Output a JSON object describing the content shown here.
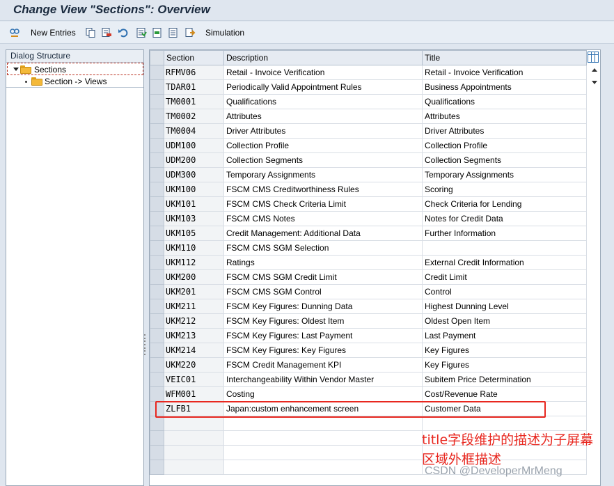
{
  "window": {
    "title": "Change View \"Sections\": Overview"
  },
  "toolbar": {
    "new_entries_label": "New Entries",
    "simulation_label": "Simulation",
    "icons": [
      "display-change-icon",
      "new-entries-icon",
      "copy-icon",
      "delete-icon",
      "undo-icon",
      "select-all-icon",
      "select-block-icon",
      "deselect-all-icon",
      "transport-icon"
    ]
  },
  "dialog_structure": {
    "header": "Dialog Structure",
    "nodes": [
      {
        "label": "Sections",
        "expanded": true,
        "selected": true
      },
      {
        "label": "Section -> Views"
      }
    ]
  },
  "table": {
    "columns": [
      "Section",
      "Description",
      "Title"
    ],
    "rows": [
      {
        "section": "RFMV06",
        "description": "Retail - Invoice Verification",
        "title": "Retail - Invoice Verification"
      },
      {
        "section": "TDAR01",
        "description": "Periodically Valid Appointment Rules",
        "title": "Business Appointments"
      },
      {
        "section": "TM0001",
        "description": "Qualifications",
        "title": "Qualifications"
      },
      {
        "section": "TM0002",
        "description": "Attributes",
        "title": "Attributes"
      },
      {
        "section": "TM0004",
        "description": "Driver Attributes",
        "title": "Driver Attributes"
      },
      {
        "section": "UDM100",
        "description": "Collection Profile",
        "title": "Collection Profile"
      },
      {
        "section": "UDM200",
        "description": "Collection Segments",
        "title": "Collection Segments"
      },
      {
        "section": "UDM300",
        "description": "Temporary Assignments",
        "title": "Temporary Assignments"
      },
      {
        "section": "UKM100",
        "description": "FSCM CMS Creditworthiness Rules",
        "title": "Scoring"
      },
      {
        "section": "UKM101",
        "description": "FSCM CMS Check Criteria Limit",
        "title": "Check Criteria for Lending"
      },
      {
        "section": "UKM103",
        "description": "FSCM CMS Notes",
        "title": "Notes for Credit Data"
      },
      {
        "section": "UKM105",
        "description": "Credit Management: Additional Data",
        "title": "Further Information"
      },
      {
        "section": "UKM110",
        "description": "FSCM CMS SGM Selection",
        "title": ""
      },
      {
        "section": "UKM112",
        "description": "Ratings",
        "title": "External Credit Information"
      },
      {
        "section": "UKM200",
        "description": "FSCM CMS SGM Credit Limit",
        "title": "Credit Limit"
      },
      {
        "section": "UKM201",
        "description": "FSCM CMS SGM Control",
        "title": "Control"
      },
      {
        "section": "UKM211",
        "description": "FSCM Key Figures: Dunning Data",
        "title": "Highest Dunning Level"
      },
      {
        "section": "UKM212",
        "description": "FSCM Key Figures: Oldest Item",
        "title": "Oldest Open Item"
      },
      {
        "section": "UKM213",
        "description": "FSCM Key Figures: Last Payment",
        "title": "Last Payment"
      },
      {
        "section": "UKM214",
        "description": "FSCM Key Figures: Key Figures",
        "title": "Key Figures"
      },
      {
        "section": "UKM220",
        "description": "FSCM Credit Management KPI",
        "title": "Key Figures"
      },
      {
        "section": "VEIC01",
        "description": "Interchangeability Within Vendor Master",
        "title": "Subitem Price Determination"
      },
      {
        "section": "WFM001",
        "description": "Costing",
        "title": "Cost/Revenue Rate"
      },
      {
        "section": "ZLFB1",
        "description": "Japan:custom enhancement screen",
        "title": "Customer Data"
      }
    ],
    "empty_rows": 4
  },
  "annotation": {
    "text": "title字段维护的描述为子屏幕区域外框描述",
    "color": "#e8271f"
  },
  "watermark": "CSDN @DeveloperMrMeng"
}
